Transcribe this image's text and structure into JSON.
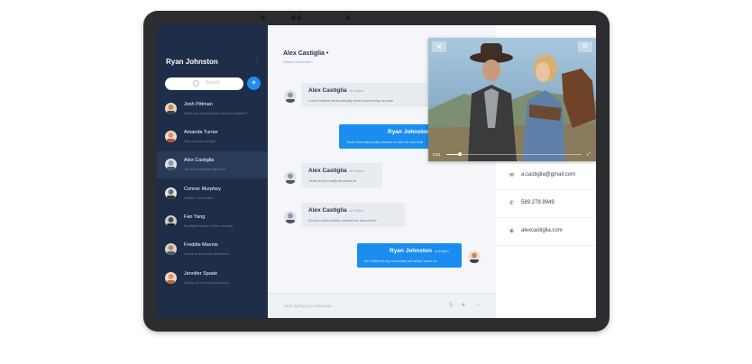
{
  "sidebar": {
    "user_name": "Ryan Johnston",
    "search_placeholder": "Search",
    "add_label": "+",
    "contacts": [
      {
        "name": "Josh Pittman",
        "preview": "Have you checked out my new jetpack?",
        "color": "#c98a5e"
      },
      {
        "name": "Amanda Turner",
        "preview": "How are you doing?",
        "color": "#d69070"
      },
      {
        "name": "Alex Castiglia",
        "preview": "Oh, so confused right now",
        "color": "#8e9aa8"
      },
      {
        "name": "Connor Murphey",
        "preview": "Coffee Tomorrow?",
        "color": "#6b6f77"
      },
      {
        "name": "Fan Yang",
        "preview": "My flight leaves in the morning",
        "color": "#4d4a4a"
      },
      {
        "name": "Freddie Mavnis",
        "preview": "I have a class this afternoon",
        "color": "#a58d6e"
      },
      {
        "name": "Jennifer Spade",
        "preview": "Going on the train tomorrow",
        "color": "#d59a6a"
      }
    ]
  },
  "chat": {
    "title": "Alex Castiglia •",
    "status": "What's awesome?",
    "messages": [
      {
        "sender": "Alex Castiglia",
        "time": "at 4:30pm",
        "text": "I can't believe what actually went down today lol wow"
      },
      {
        "sender": "Ryan Johnston",
        "time": "",
        "text": "Yeah! that was pretty intense lol did not see that"
      },
      {
        "sender": "Alex Castiglia",
        "time": "at 5:00pm",
        "text": "Yeah lol just really shocked lol"
      },
      {
        "sender": "Alex Castiglia",
        "time": "at 5:00pm",
        "text": "Do you know what's needed for tomorrow?"
      },
      {
        "sender": "Ryan Johnston",
        "time": "at 5:05pm",
        "text": "No I think it's fry and finish out what I store on"
      }
    ],
    "composer_placeholder": "Start typing your message..."
  },
  "info": {
    "email": "a.castiglia@gmail.com",
    "phone": "589.278.9949",
    "website": "alexcastiglia.com"
  },
  "video": {
    "close_label": "✕",
    "time": "0:21",
    "progress": 0.1
  },
  "colors": {
    "sidebar": "#1e2d48",
    "accent": "#1a8df0",
    "bezel": "#2b2d31"
  }
}
